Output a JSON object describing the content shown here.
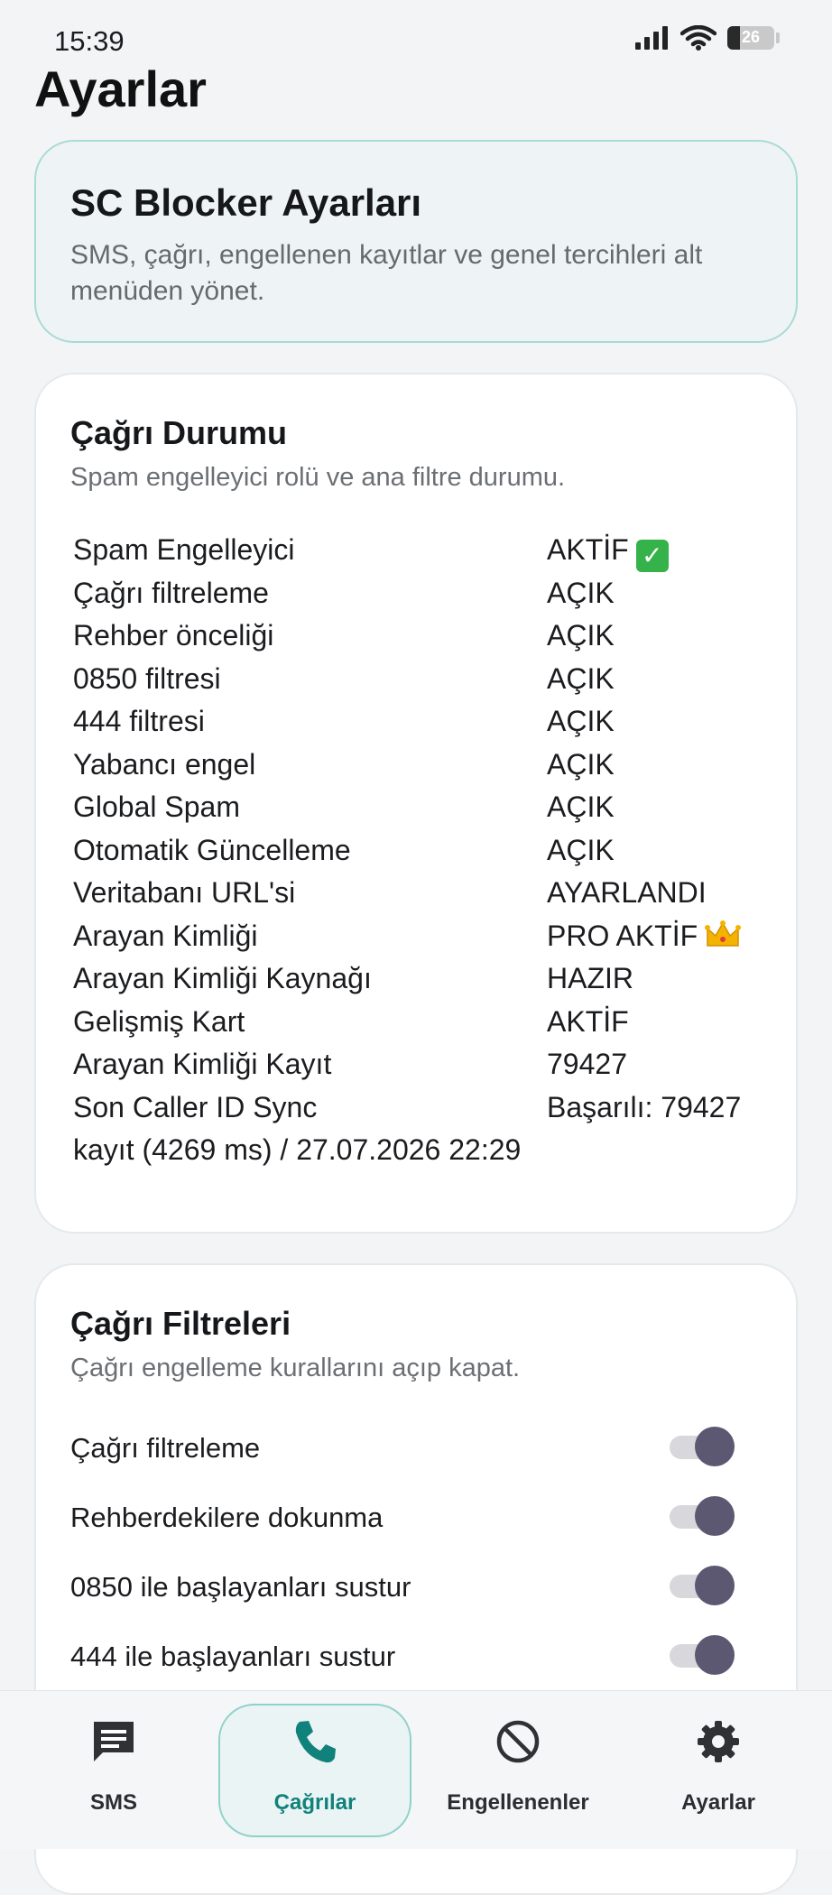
{
  "status_bar": {
    "time": "15:39",
    "battery": "26",
    "battery_level": 0.26,
    "icons": [
      "signal-icon",
      "wifi-icon",
      "battery-icon"
    ]
  },
  "page": {
    "title": "Ayarlar"
  },
  "hero": {
    "title": "SC Blocker Ayarları",
    "description": "SMS, çağrı, engellenen kayıtlar ve genel tercihleri alt menüden yönet."
  },
  "call_status": {
    "title": "Çağrı Durumu",
    "subtitle": "Spam engelleyici rolü ve ana filtre durumu.",
    "rows": [
      {
        "label": "Spam Engelleyici",
        "value": "AKTİF"
      },
      {
        "label": "Çağrı filtreleme",
        "value": "AÇIK"
      },
      {
        "label": "Rehber önceliği",
        "value": "AÇIK"
      },
      {
        "label": "0850 filtresi",
        "value": "AÇIK"
      },
      {
        "label": "444 filtresi",
        "value": "AÇIK"
      },
      {
        "label": "Yabancı engel",
        "value": "AÇIK"
      },
      {
        "label": "Global Spam",
        "value": "AÇIK"
      },
      {
        "label": "Otomatik Güncelleme",
        "value": "AÇIK"
      },
      {
        "label": "Veritabanı URL'si",
        "value": "AYARLANDI"
      },
      {
        "label": "Arayan Kimliği",
        "value": "PRO AKTİF"
      },
      {
        "label": "Arayan Kimliği Kaynağı",
        "value": "HAZIR"
      },
      {
        "label": "Gelişmiş Kart",
        "value": "AKTİF"
      },
      {
        "label": "Arayan Kimliği Kayıt",
        "value": "79427"
      },
      {
        "label": "Son Caller ID Sync",
        "value": "Başarılı: 79427"
      }
    ],
    "wrap_line": "kayıt (4269 ms) / 27.07.2026 22:29"
  },
  "call_filters": {
    "title": "Çağrı Filtreleri",
    "subtitle": "Çağrı engelleme kurallarını açıp kapat.",
    "toggles": [
      {
        "label": "Çağrı filtreleme",
        "on": true
      },
      {
        "label": "Rehberdekilere dokunma",
        "on": true
      },
      {
        "label": "0850 ile başlayanları sustur",
        "on": true
      },
      {
        "label": "444 ile başlayanları sustur",
        "on": true
      }
    ]
  },
  "bottom_nav": {
    "items": [
      {
        "label": "SMS",
        "icon": "message-icon",
        "active": false
      },
      {
        "label": "Çağrılar",
        "icon": "phone-icon",
        "active": true
      },
      {
        "label": "Engellenenler",
        "icon": "block-icon",
        "active": false
      },
      {
        "label": "Ayarlar",
        "icon": "gear-icon",
        "active": false
      }
    ]
  },
  "colors": {
    "accent": "#11827b",
    "toggle_thumb": "#5c5872",
    "hero_border": "#a9dbd6"
  }
}
